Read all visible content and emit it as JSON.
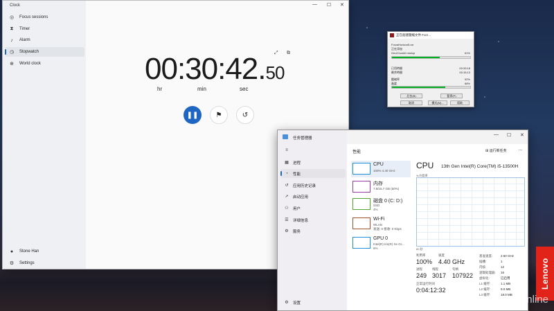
{
  "desktop": {
    "brand": "Lenovo",
    "watermark": "PConline"
  },
  "clock": {
    "app_title": "Clock",
    "nav": [
      {
        "label": "Focus sessions",
        "icon": "focus-icon"
      },
      {
        "label": "Timer",
        "icon": "hourglass-icon"
      },
      {
        "label": "Alarm",
        "icon": "bell-icon"
      },
      {
        "label": "Stopwatch",
        "icon": "stopwatch-icon",
        "active": true
      },
      {
        "label": "World clock",
        "icon": "globe-icon"
      }
    ],
    "user": "Stone Han",
    "settings": "Settings",
    "time": {
      "main": "00:30:42.",
      "fraction": "50"
    },
    "units": {
      "hr": "hr",
      "min": "min",
      "sec": "sec"
    },
    "buttons": {
      "pause": "❚❚",
      "lap": "⚑",
      "reset": "↺"
    }
  },
  "winrar": {
    "title": "正在創建壓縮文件 Forz...",
    "archive": "ForzaHorizon5.rar",
    "adding_label": "正在添加",
    "file": "GeoChunk0.mmlzp",
    "file_pct": "61%",
    "elapsed_label": "已用時間",
    "elapsed": "00:33:18",
    "remaining_label": "剩余時間",
    "remaining": "00:15:13",
    "ratio_label": "壓縮率",
    "ratio": "92%",
    "progress_label": "進度",
    "progress": "68%",
    "file_bar": 0.61,
    "total_bar": 0.68,
    "buttons": [
      "后台(B)",
      "暫停(P)",
      "取消",
      "模式(M)...",
      "幫助"
    ]
  },
  "taskmgr": {
    "title": "任务管理器",
    "nav": [
      {
        "label": "进程",
        "icon": "processes-icon"
      },
      {
        "label": "性能",
        "icon": "performance-icon",
        "active": true
      },
      {
        "label": "应用历史记录",
        "icon": "history-icon"
      },
      {
        "label": "启动应用",
        "icon": "startup-icon"
      },
      {
        "label": "用户",
        "icon": "users-icon"
      },
      {
        "label": "详细信息",
        "icon": "details-icon"
      },
      {
        "label": "服务",
        "icon": "services-icon"
      }
    ],
    "settings": "设置",
    "header": "性能",
    "run_task": "运行新任务",
    "perf_items": [
      {
        "name": "CPU",
        "sub": [
          "100%  4.40 GHz"
        ],
        "color": "#1f8fd9"
      },
      {
        "name": "内存",
        "sub": [
          "7.8/15.7 GB (50%)"
        ],
        "color": "#9b3da8"
      },
      {
        "name": "磁盘 0 (C: D:)",
        "sub": [
          "SSD",
          "4%"
        ],
        "color": "#4ea72e"
      },
      {
        "name": "Wi-Fi",
        "sub": [
          "WLAN",
          "发送: 0  接收: 0 Kbps"
        ],
        "color": "#a0522d"
      },
      {
        "name": "GPU 0",
        "sub": [
          "Intel(R) Iris(R) Xe Gr...",
          "6%"
        ],
        "color": "#1f8fd9"
      }
    ],
    "cpu_title": "CPU",
    "cpu_model": "13th Gen Intel(R) Core(TM) i5-13500H",
    "graph_top": "% 利用率",
    "graph_bottom": "60 秒",
    "stats": {
      "util_label": "利用率",
      "util": "100%",
      "speed_label": "速度",
      "speed": "4.40 GHz",
      "proc_label": "进程",
      "proc": "249",
      "thread_label": "线程",
      "thread": "3017",
      "handle_label": "句柄",
      "handle": "107922",
      "uptime_label": "正常运行时间",
      "uptime": "0:04:12:32"
    },
    "info": [
      {
        "k": "基准速度:",
        "v": "2.60 GHz"
      },
      {
        "k": "插槽:",
        "v": "1"
      },
      {
        "k": "内核:",
        "v": "12"
      },
      {
        "k": "逻辑处理器:",
        "v": "16"
      },
      {
        "k": "虚拟化:",
        "v": "已启用"
      },
      {
        "k": "L1 缓存:",
        "v": "1.1 MB"
      },
      {
        "k": "L2 缓存:",
        "v": "9.0 MB"
      },
      {
        "k": "L3 缓存:",
        "v": "18.0 MB"
      }
    ]
  }
}
